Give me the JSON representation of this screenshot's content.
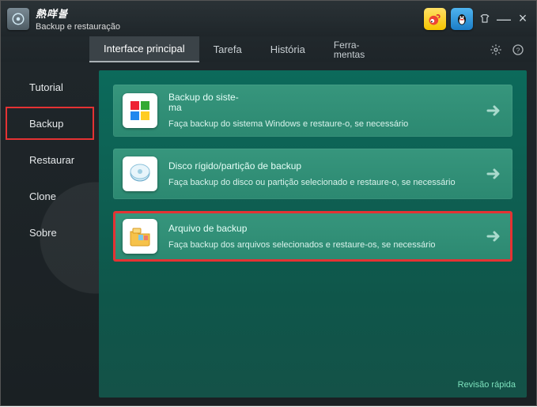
{
  "brand": {
    "logo_text": "熱咩볼",
    "subtitle": "Backup e restauração"
  },
  "window_controls": {
    "pin_icon": "pin",
    "minimize": "−",
    "close": "×"
  },
  "topnav": {
    "tabs": [
      {
        "label": "Interface principal"
      },
      {
        "label": "Tarefa"
      },
      {
        "label": "História"
      },
      {
        "label": "Ferra-\nmentas"
      }
    ],
    "active_index": 0
  },
  "sidebar": {
    "items": [
      {
        "label": "Tutorial"
      },
      {
        "label": "Backup"
      },
      {
        "label": "Restaurar"
      },
      {
        "label": "Clone"
      },
      {
        "label": "Sobre"
      }
    ],
    "selected_index": 1
  },
  "cards": [
    {
      "title": "Backup do siste-\nma",
      "sub": "",
      "desc": "Faça backup do sistema Windows e restaure-o, se necessário",
      "icon": "windows-logo",
      "highlight": false
    },
    {
      "title": "Disco rígido/partição de backup",
      "sub": "",
      "desc": "Faça backup do disco ou partição selecionado e restaure-o, se necessário",
      "icon": "disk",
      "highlight": false
    },
    {
      "title": "Arquivo de backup",
      "sub": "",
      "desc": "Faça backup dos arquivos selecionados e restaure-os, se necessário",
      "icon": "folder",
      "highlight": true
    }
  ],
  "footer": {
    "quick_review": "Revisão rápida"
  },
  "colors": {
    "accent_red": "#e53233",
    "panel_green": "#0f6557"
  }
}
